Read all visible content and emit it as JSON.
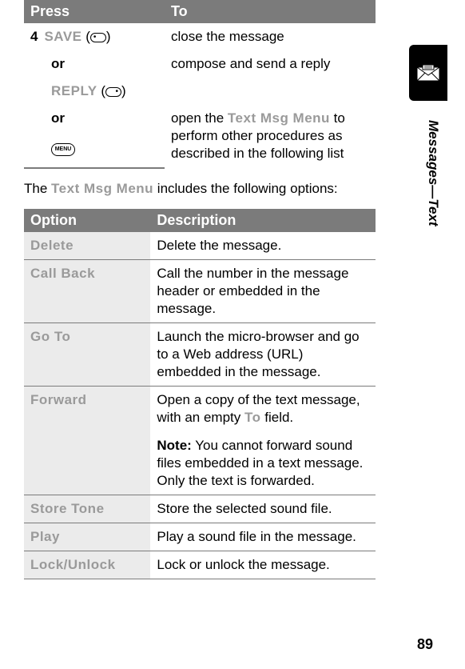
{
  "tab_label": "Messages—Text",
  "page_number": "89",
  "table1": {
    "headers": {
      "press": "Press",
      "to": "To"
    },
    "step": "4",
    "save_label": "SAVE",
    "save_desc": "close the message",
    "or1": "or",
    "reply_label": "REPLY",
    "reply_desc": "compose and send a reply",
    "or2": "or",
    "menu_label": "MENU",
    "menu_desc_pre": "open the ",
    "menu_desc_code": "Text Msg Menu",
    "menu_desc_post": " to perform other procedures as described in the following list"
  },
  "intro_pre": "The ",
  "intro_code": "Text Msg Menu",
  "intro_post": " includes the following options:",
  "table2": {
    "headers": {
      "option": "Option",
      "description": "Description"
    },
    "rows": {
      "delete": {
        "opt": "Delete",
        "desc": "Delete the message."
      },
      "callback": {
        "opt": "Call Back",
        "desc": "Call the number in the message header or embedded in the message."
      },
      "goto": {
        "opt": "Go To",
        "desc": "Launch the micro-browser and go to a Web address (URL) embedded in the message."
      },
      "forward": {
        "opt": "Forward",
        "desc_pre": "Open a copy of the text message, with an empty ",
        "desc_code": "To",
        "desc_post": " field.",
        "note_label": "Note:",
        "note_text": " You cannot forward sound files embedded in a text message. Only the text is forwarded."
      },
      "storetone": {
        "opt": "Store Tone",
        "desc": "Store the selected sound file."
      },
      "play": {
        "opt": "Play",
        "desc": "Play a sound file in the message."
      },
      "lock": {
        "opt": "Lock/Unlock",
        "desc": "Lock or unlock the message."
      }
    }
  }
}
